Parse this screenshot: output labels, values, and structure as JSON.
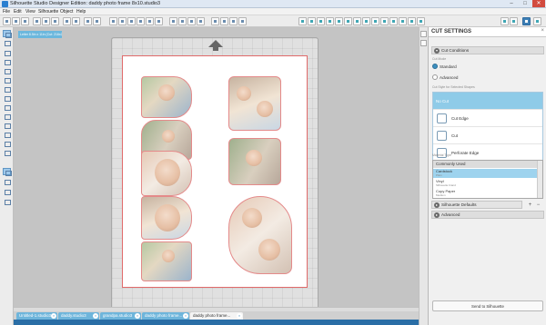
{
  "window": {
    "title": "Silhouette Studio Designer Edition: daddy photo frame 8x10.studio3"
  },
  "menu": [
    "File",
    "Edit",
    "View",
    "Silhouette",
    "Object",
    "Help"
  ],
  "page_label": "Letter 8.5in x 11in (Cut: 216x279)",
  "cut_settings": {
    "header": "CUT SETTINGS",
    "section_cut_conditions": "Cut Conditions",
    "cut_mode_label": "Cut Mode",
    "mode_standard": "Standard",
    "mode_advanced": "Advanced",
    "style_caption": "Cut Style for Selected Shapes",
    "styles": [
      "No Cut",
      "Cut Edge",
      "Cut",
      "Perforate Edge",
      "Perforate"
    ],
    "material_caption": "Material Type",
    "material_group": "Commonly Used",
    "materials": [
      {
        "name": "Cardstock",
        "sub": "Plain"
      },
      {
        "name": "Vinyl",
        "sub": "Silhouette brand"
      },
      {
        "name": "Copy Paper",
        "sub": "Medium"
      }
    ],
    "silhouette_defaults": "Silhouette Defaults",
    "section_advanced": "Advanced",
    "send_button": "Send to Silhouette"
  },
  "tabs": [
    {
      "label": "Untitled-1.studio3"
    },
    {
      "label": "daddy.studio3"
    },
    {
      "label": "grandpa.studio3"
    },
    {
      "label": "daddy photo frame..."
    },
    {
      "label": "daddy photo frame..."
    }
  ]
}
